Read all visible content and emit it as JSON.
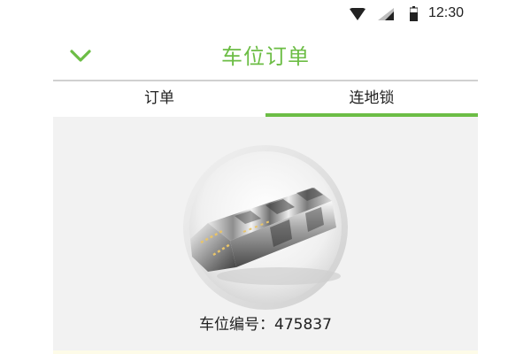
{
  "status_bar": {
    "time": "12:30",
    "icons": [
      "wifi-icon",
      "signal-icon",
      "battery-icon"
    ]
  },
  "header": {
    "back_icon": "chevron-down-icon",
    "title": "车位订单"
  },
  "tabs": [
    {
      "label": "订单",
      "active": false
    },
    {
      "label": "连地锁",
      "active": true
    }
  ],
  "main": {
    "image": "parking-lock-image",
    "spot_number_label": "车位编号：475837"
  },
  "colors": {
    "accent": "#6cbd45",
    "background": "#f2f2f2",
    "divider": "#d0d0d0"
  }
}
